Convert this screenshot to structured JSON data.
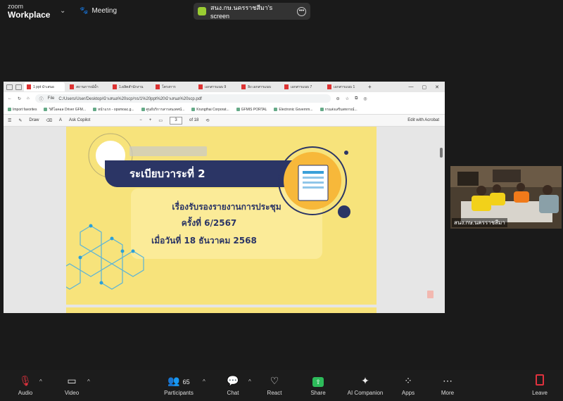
{
  "brand": {
    "line1": "zoom",
    "line2": "Workplace"
  },
  "meeting_label": "Meeting",
  "share_banner": {
    "text": "สนง.กษ.นครราชสีมา's screen"
  },
  "browser": {
    "tabs": [
      {
        "label": "1 ppt นำเสนอ"
      },
      {
        "label": "สถานการณ์น้ำ"
      },
      {
        "label": "1.ผลิตสำนักงาน"
      },
      {
        "label": "โครงการ"
      },
      {
        "label": "เอกสารแนบ 9"
      },
      {
        "label": "ลิง เอกสารแนบ"
      },
      {
        "label": "เอกสารแนบ 7"
      },
      {
        "label": "เอกสารแนบ 1"
      }
    ],
    "address_prefix": "File",
    "url": "C:/Users/User/Desktop/นำเสนอ%20scp/รธ/1%20ppt%20นำเสนอ%20scp.pdf",
    "bookmarks": [
      "Import favorites",
      "วิดีโอคอล Driver GFM...",
      "หน้าแรก - opsmoac.g...",
      "ศูนย์บริการสารสนเทศน์...",
      "Krungthai Corporat...",
      "GFMIS PORTAL",
      "Electronic Governm...",
      "กรมส่งเสริมสหกรณ์..."
    ],
    "pdf_toolbar": {
      "draw": "Draw",
      "ask_copilot": "Ask Copilot",
      "page": "3",
      "of_pages": "of 18",
      "edit_acrobat": "Edit with Acrobat"
    }
  },
  "slide": {
    "title": "ระเบียบวาระที่ 2",
    "line1": "เรื่องรับรองรายงานการประชุม",
    "line2": "ครั้งที่ 6/2567",
    "line3": "เมื่อวันที่ 18 ธันวาคม 2568"
  },
  "video": {
    "label": "สนง.กษ.นครราชสีมา"
  },
  "controls": {
    "audio": "Audio",
    "video": "Video",
    "participants": "Participants",
    "participant_count": "65",
    "chat": "Chat",
    "react": "React",
    "share": "Share",
    "ai_companion": "AI Companion",
    "apps": "Apps",
    "more": "More",
    "leave": "Leave"
  },
  "colors": {
    "slide_yellow": "#f7e37b",
    "navy": "#2b3565",
    "share_green": "#2dbb5a",
    "leave_red": "#e0323e"
  }
}
